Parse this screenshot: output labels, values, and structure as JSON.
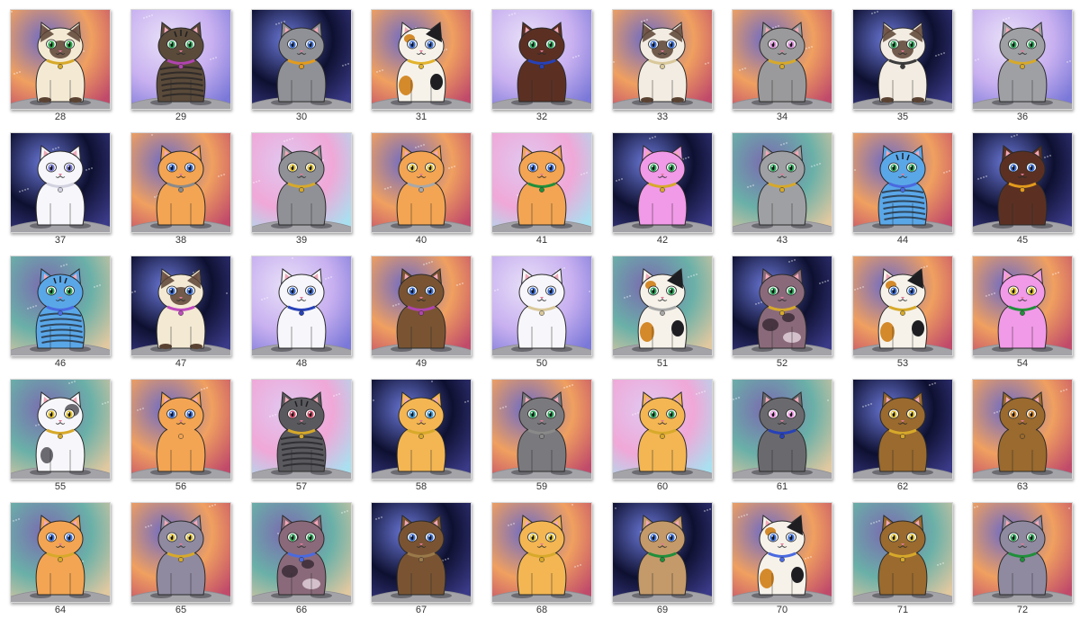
{
  "gallery": {
    "items": [
      {
        "label": "28",
        "bg": "nebula-orange",
        "fur": "#f4ead4",
        "pattern": "siamese",
        "eyes": "#29a846",
        "collar": "#d7a92a"
      },
      {
        "label": "29",
        "bg": "purple-haze",
        "fur": "#5a4a3a",
        "pattern": "tabby",
        "eyes": "#2aa558",
        "collar": "#b044b0"
      },
      {
        "label": "30",
        "bg": "deep-space",
        "fur": "#8f9196",
        "pattern": "none",
        "eyes": "#3a6ed8",
        "collar": "#e39b1d"
      },
      {
        "label": "31",
        "bg": "nebula-orange",
        "fur": "#f6f2ea",
        "pattern": "calico",
        "eyes": "#3a6ed8",
        "collar": "#e2b32c"
      },
      {
        "label": "32",
        "bg": "purple-haze",
        "fur": "#5b3022",
        "pattern": "none",
        "eyes": "#2aa558",
        "collar": "#2741b8"
      },
      {
        "label": "33",
        "bg": "nebula-orange",
        "fur": "#f2ece2",
        "pattern": "siamese",
        "eyes": "#3a6ed8",
        "collar": "#d9c89a"
      },
      {
        "label": "34",
        "bg": "nebula-orange",
        "fur": "#9a9a9c",
        "pattern": "none",
        "eyes": "#d98ad8",
        "collar": "#d7a92a"
      },
      {
        "label": "35",
        "bg": "deep-space",
        "fur": "#f2ece2",
        "pattern": "siamese",
        "eyes": "#2aa558",
        "collar": "#3c3c3c"
      },
      {
        "label": "36",
        "bg": "purple-haze",
        "fur": "#9ea0a4",
        "pattern": "none",
        "eyes": "#2aa558",
        "collar": "#d7a92a"
      },
      {
        "label": "37",
        "bg": "deep-space",
        "fur": "#f7f7fb",
        "pattern": "none",
        "eyes": "#7a7ad8",
        "collar": "#d2d2e0"
      },
      {
        "label": "38",
        "bg": "nebula-orange",
        "fur": "#f3a553",
        "pattern": "none",
        "eyes": "#3a6ed8",
        "collar": "#8a8a8a"
      },
      {
        "label": "39",
        "bg": "pink-sky",
        "fur": "#8f9196",
        "pattern": "none",
        "eyes": "#e3c22a",
        "collar": "#d7a92a"
      },
      {
        "label": "40",
        "bg": "nebula-orange",
        "fur": "#f3a553",
        "pattern": "none",
        "eyes": "#e3c22a",
        "collar": "#a8a8a8"
      },
      {
        "label": "41",
        "bg": "pink-sky",
        "fur": "#f3a553",
        "pattern": "none",
        "eyes": "#3a6ed8",
        "collar": "#1f8f3a"
      },
      {
        "label": "42",
        "bg": "deep-space",
        "fur": "#f19ae8",
        "pattern": "none",
        "eyes": "#2aa558",
        "collar": "#d7a92a"
      },
      {
        "label": "43",
        "bg": "teal-nebula",
        "fur": "#9ea0a4",
        "pattern": "none",
        "eyes": "#2aa558",
        "collar": "#d7a92a"
      },
      {
        "label": "44",
        "bg": "nebula-orange",
        "fur": "#5aa7e8",
        "pattern": "tabby",
        "eyes": "#2aa558",
        "collar": "#4a6ae0"
      },
      {
        "label": "45",
        "bg": "deep-space",
        "fur": "#5b3022",
        "pattern": "none",
        "eyes": "#3a6ed8",
        "collar": "#e39b1d"
      },
      {
        "label": "46",
        "bg": "teal-nebula",
        "fur": "#5aa7e8",
        "pattern": "tabby",
        "eyes": "#2aa558",
        "collar": "#4a6ae0"
      },
      {
        "label": "47",
        "bg": "deep-space",
        "fur": "#f4ead4",
        "pattern": "siamese",
        "eyes": "#3a6ed8",
        "collar": "#c04ac0"
      },
      {
        "label": "48",
        "bg": "purple-haze",
        "fur": "#f7f7fb",
        "pattern": "none",
        "eyes": "#3a6ed8",
        "collar": "#2741b8"
      },
      {
        "label": "49",
        "bg": "nebula-orange",
        "fur": "#7a5432",
        "pattern": "none",
        "eyes": "#3a6ed8",
        "collar": "#b044b0"
      },
      {
        "label": "50",
        "bg": "purple-haze",
        "fur": "#f7f7fb",
        "pattern": "none",
        "eyes": "#3a6ed8",
        "collar": "#d9c89a"
      },
      {
        "label": "51",
        "bg": "teal-nebula",
        "fur": "#f6f2ea",
        "pattern": "calico",
        "eyes": "#2aa558",
        "collar": "#a8a8a8"
      },
      {
        "label": "52",
        "bg": "deep-space",
        "fur": "#8a6a7a",
        "pattern": "tortie",
        "eyes": "#2aa558",
        "collar": "#d7a92a"
      },
      {
        "label": "53",
        "bg": "nebula-orange",
        "fur": "#f6f2ea",
        "pattern": "calico",
        "eyes": "#3a6ed8",
        "collar": "#d7a92a"
      },
      {
        "label": "54",
        "bg": "nebula-orange",
        "fur": "#f19ae8",
        "pattern": "none",
        "eyes": "#e3c22a",
        "collar": "#1f8f3a"
      },
      {
        "label": "55",
        "bg": "teal-nebula",
        "fur": "#f7f7fb",
        "pattern": "calico-gray",
        "eyes": "#e3c22a",
        "collar": "#d7a92a"
      },
      {
        "label": "56",
        "bg": "nebula-orange",
        "fur": "#f3a553",
        "pattern": "none",
        "eyes": "#3a6ed8",
        "collar": "#f3a553"
      },
      {
        "label": "57",
        "bg": "pink-sky",
        "fur": "#5a5a5e",
        "pattern": "tabby",
        "eyes": "#d94a6a",
        "collar": "#d7a92a"
      },
      {
        "label": "58",
        "bg": "deep-space",
        "fur": "#f3b653",
        "pattern": "none",
        "eyes": "#3a9ad8",
        "collar": "#d7a92a"
      },
      {
        "label": "59",
        "bg": "nebula-orange",
        "fur": "#7a7a7e",
        "pattern": "none",
        "eyes": "#2aa558",
        "collar": "#8a8a8a"
      },
      {
        "label": "60",
        "bg": "pink-sky",
        "fur": "#f3b653",
        "pattern": "none",
        "eyes": "#2aa558",
        "collar": "#d7a92a"
      },
      {
        "label": "61",
        "bg": "teal-nebula",
        "fur": "#6a6a6e",
        "pattern": "none",
        "eyes": "#f19ae8",
        "collar": "#2741b8"
      },
      {
        "label": "62",
        "bg": "deep-space",
        "fur": "#9a6a2e",
        "pattern": "none",
        "eyes": "#e3c22a",
        "collar": "#d7a92a"
      },
      {
        "label": "63",
        "bg": "nebula-orange",
        "fur": "#9a6a2e",
        "pattern": "none",
        "eyes": "#d98a2a",
        "collar": "#9a6a2e"
      },
      {
        "label": "64",
        "bg": "teal-nebula",
        "fur": "#f3a553",
        "pattern": "none",
        "eyes": "#3a6ed8",
        "collar": "#d7a92a"
      },
      {
        "label": "65",
        "bg": "nebula-orange",
        "fur": "#8f8aa0",
        "pattern": "none",
        "eyes": "#e3c22a",
        "collar": "#d7a92a"
      },
      {
        "label": "66",
        "bg": "teal-nebula",
        "fur": "#8a6a7a",
        "pattern": "tortie",
        "eyes": "#2aa558",
        "collar": "#4a6ae0"
      },
      {
        "label": "67",
        "bg": "deep-space",
        "fur": "#7a5432",
        "pattern": "none",
        "eyes": "#3a6ed8",
        "collar": "#9a7a4a"
      },
      {
        "label": "68",
        "bg": "nebula-orange",
        "fur": "#f3b653",
        "pattern": "none",
        "eyes": "#e3c22a",
        "collar": "#d7a92a"
      },
      {
        "label": "69",
        "bg": "deep-space",
        "fur": "#c49a6a",
        "pattern": "none",
        "eyes": "#3a6ed8",
        "collar": "#1f8f3a"
      },
      {
        "label": "70",
        "bg": "nebula-orange",
        "fur": "#f6f2ea",
        "pattern": "calico",
        "eyes": "#3a6ed8",
        "collar": "#4a6ae0"
      },
      {
        "label": "71",
        "bg": "teal-nebula",
        "fur": "#9a6a2e",
        "pattern": "none",
        "eyes": "#e3c22a",
        "collar": "#d7a92a"
      },
      {
        "label": "72",
        "bg": "nebula-orange",
        "fur": "#8f8aa0",
        "pattern": "none",
        "eyes": "#2aa558",
        "collar": "#1f8f3a"
      }
    ]
  },
  "backgrounds": {
    "nebula-orange": [
      "#f0a060",
      "#c04a6a",
      "#6a6ac8"
    ],
    "purple-haze": [
      "#c8b0f0",
      "#7a78d8",
      "#e8e0f8"
    ],
    "deep-space": [
      "#0e1030",
      "#3a3a88",
      "#6a78d8"
    ],
    "pink-sky": [
      "#f0a8d8",
      "#a8e0f0",
      "#e0c8f0"
    ],
    "teal-nebula": [
      "#6ab0a8",
      "#e0c8a0",
      "#7a6ab0"
    ]
  }
}
